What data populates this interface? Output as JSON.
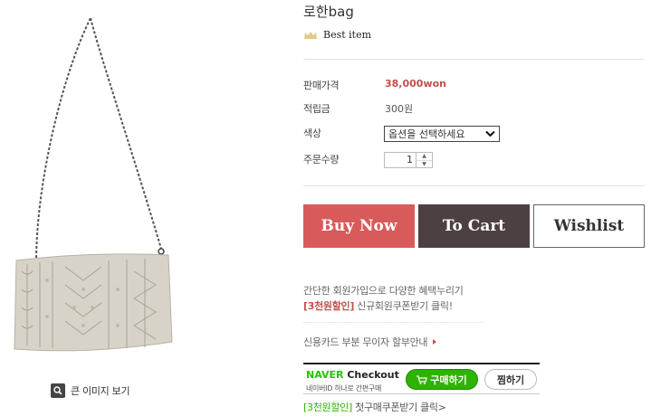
{
  "product": {
    "name": "로한bag",
    "badge": "Best item",
    "zoom_label": "큰 이미지 보기"
  },
  "details": {
    "price_label": "판매가격",
    "price_value": "38,000won",
    "points_label": "적립금",
    "points_value": "300원",
    "color_label": "색상",
    "color_select": "옵션을 선택하세요",
    "qty_label": "주문수량",
    "qty_value": "1"
  },
  "actions": {
    "buy_now": "Buy Now",
    "to_cart": "To Cart",
    "wishlist": "Wishlist"
  },
  "promo": {
    "line1": "간단한 회원가입으로 다양한 혜택누리기",
    "coupon_tag": "[3천원할인]",
    "coupon_link": "신규회원쿠폰받기 클릭!",
    "card_info": "신용카드 부분 무이자 할부안내"
  },
  "naver": {
    "logo_naver": "NAVER",
    "logo_checkout": "Checkout",
    "sub": "네이버ID 하나로 간편구매",
    "buy_label": "구매하기",
    "wish_label": "찜하기",
    "coupon_tag": "[3천원할인]",
    "coupon_text": "첫구매쿠폰받기 클릭>"
  },
  "colors": {
    "buy": "#d95a5a",
    "cart": "#4d4042",
    "price": "#c0504d",
    "naver_green": "#2db400"
  }
}
